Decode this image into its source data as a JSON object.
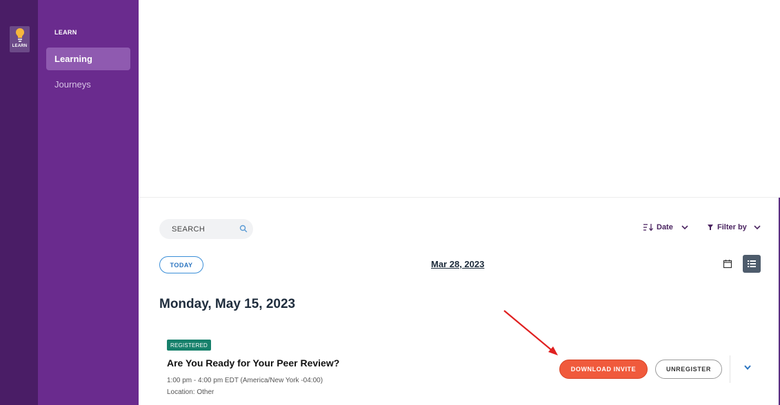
{
  "rail": {
    "app_label": "LEARN",
    "app_icon": "lightbulb-icon"
  },
  "nav": {
    "heading": "LEARN",
    "items": [
      {
        "label": "Learning",
        "active": true
      },
      {
        "label": "Journeys",
        "active": false
      }
    ]
  },
  "toolbar": {
    "search_placeholder": "SEARCH",
    "sort_label": "Date",
    "filter_label": "Filter by"
  },
  "date_nav": {
    "today_label": "TODAY",
    "current_date": "Mar 28, 2023"
  },
  "day": {
    "heading": "Monday, May 15, 2023",
    "events": [
      {
        "badge": "REGISTERED",
        "title": "Are You Ready for Your Peer Review?",
        "time": "1:00 pm - 4:00 pm EDT (America/New York -04:00)",
        "location": "Location: Other",
        "primary_action": "DOWNLOAD INVITE",
        "secondary_action": "UNREGISTER"
      }
    ]
  },
  "colors": {
    "rail": "#4a1d66",
    "nav": "#6a2b8e",
    "nav_active": "#8f5ab0",
    "badge": "#16806b",
    "download": "#f05a3c",
    "link": "#2a74c0",
    "annotation_arrow": "#e02020"
  }
}
